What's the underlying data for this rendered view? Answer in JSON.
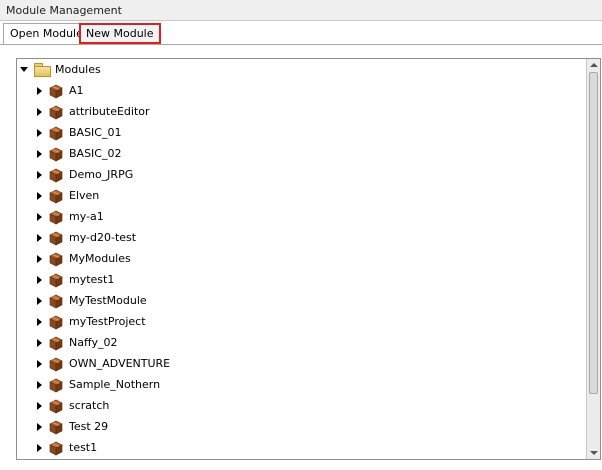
{
  "window": {
    "title": "Module Management"
  },
  "tabs": [
    {
      "label": "Open Module",
      "active": true
    },
    {
      "label": "New Module",
      "active": false,
      "highlighted": true
    }
  ],
  "tree": {
    "root": {
      "label": "Modules",
      "expanded": true,
      "icon": "folder-icon"
    },
    "items": [
      {
        "label": "A1"
      },
      {
        "label": "attributeEditor"
      },
      {
        "label": "BASIC_01"
      },
      {
        "label": "BASIC_02"
      },
      {
        "label": "Demo_JRPG"
      },
      {
        "label": "Elven"
      },
      {
        "label": "my-a1"
      },
      {
        "label": "my-d20-test"
      },
      {
        "label": "MyModules"
      },
      {
        "label": "mytest1"
      },
      {
        "label": "MyTestModule"
      },
      {
        "label": "myTestProject"
      },
      {
        "label": "Naffy_02"
      },
      {
        "label": "OWN_ADVENTURE"
      },
      {
        "label": "Sample_Nothern"
      },
      {
        "label": "scratch"
      },
      {
        "label": "Test 29"
      },
      {
        "label": "test1"
      }
    ],
    "item_icon": "module-box-icon"
  },
  "colors": {
    "highlight": "#e02020",
    "box": "#8b4a1e"
  }
}
